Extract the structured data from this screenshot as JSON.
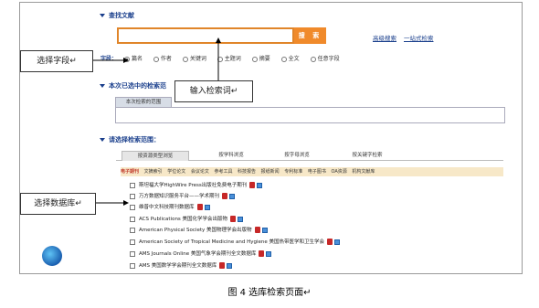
{
  "search_section": {
    "title": "查找文献",
    "search_button": "搜 索",
    "input_value": "",
    "advanced_link": "高级搜索",
    "onestop_link": "一站式检索"
  },
  "fields": {
    "label": "字段：",
    "options": [
      "篇名",
      "作者",
      "关键词",
      "主题词",
      "摘要",
      "全文",
      "任意字段"
    ],
    "selected": "篇名"
  },
  "scope_section": {
    "title": "本次已选中的检索范",
    "tab_label": "本次检索的范围"
  },
  "db_section": {
    "title": "请选择检索范围：",
    "tabs": [
      "按资源类型浏览",
      "按学科浏览",
      "按字母浏览",
      "按关键字检索"
    ],
    "active_tab": "按资源类型浏览",
    "categories": [
      "电子期刊",
      "文摘索引",
      "学位论文",
      "会议论文",
      "参考工具",
      "科技报告",
      "报纸新闻",
      "专利标准",
      "电子图书",
      "OA资源",
      "机构文献库"
    ],
    "active_category": "电子期刊",
    "databases": [
      "斯坦福大学HighWire Press出版社免费电子期刊",
      "万方数据知识服务平台——学术期刊",
      "维普中文科技期刊数据库",
      "ACS Publications 美国化学学会出版物",
      "American Physical Society 美国物理学会出版物",
      "American Society of Tropical Medicine and Hygiene 美国热带医学和卫生学会",
      "AMS Journals Online 美国气象学会期刊全文数据库",
      "AMS 美国数学学会期刊全文数据库"
    ]
  },
  "callouts": {
    "select_field": "选择字段↵",
    "input_term": "输入检索词↵",
    "select_db": "选择数据库↵"
  },
  "caption": "图 4 选库检索页面↵",
  "colors": {
    "accent": "#f08a2b",
    "title": "#1a3f8c",
    "category_bar": "#f7e8c8"
  }
}
